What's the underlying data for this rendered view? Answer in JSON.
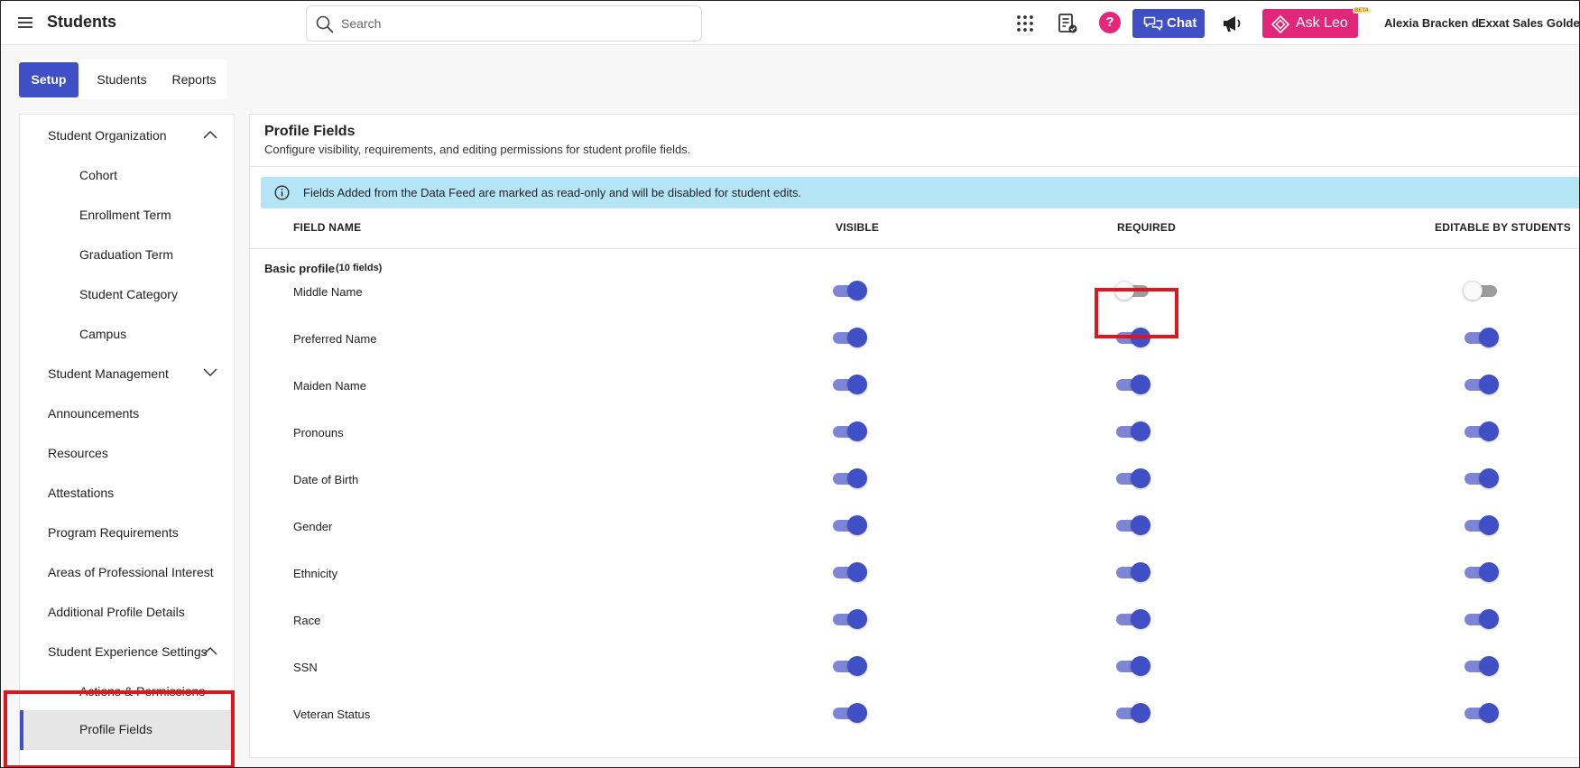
{
  "header": {
    "app_title": "Students",
    "search_placeholder": "Search",
    "chat_label": "Chat",
    "ask_leo_label": "Ask Leo",
    "beta_badge": "BETA",
    "help_label": "?",
    "user_name": "Alexia Bracken d",
    "org_name": "Exxat Sales Golden"
  },
  "tabs": [
    {
      "label": "Setup",
      "active": true
    },
    {
      "label": "Students",
      "active": false
    },
    {
      "label": "Reports",
      "active": false
    }
  ],
  "sidebar": {
    "items": [
      {
        "label": "Student Organization",
        "level": 0,
        "chevron": "up"
      },
      {
        "label": "Cohort",
        "level": 1
      },
      {
        "label": "Enrollment Term",
        "level": 1
      },
      {
        "label": "Graduation Term",
        "level": 1
      },
      {
        "label": "Student Category",
        "level": 1
      },
      {
        "label": "Campus",
        "level": 1
      },
      {
        "label": "Student Management",
        "level": 0,
        "chevron": "down"
      },
      {
        "label": "Announcements",
        "level": 0
      },
      {
        "label": "Resources",
        "level": 0
      },
      {
        "label": "Attestations",
        "level": 0
      },
      {
        "label": "Program Requirements",
        "level": 0
      },
      {
        "label": "Areas of Professional Interest",
        "level": 0
      },
      {
        "label": "Additional Profile Details",
        "level": 0
      },
      {
        "label": "Student Experience Settings",
        "level": 0,
        "chevron": "up"
      },
      {
        "label": "Actions & Permissions",
        "level": 1
      },
      {
        "label": "Profile Fields",
        "level": 1,
        "selected": true
      }
    ]
  },
  "panel": {
    "title": "Profile Fields",
    "subtitle": "Configure visibility, requirements, and editing permissions for student profile fields.",
    "info_banner": "Fields Added from the Data Feed are marked as read-only and will be disabled for student edits.",
    "columns": {
      "field_name": "FIELD NAME",
      "visible": "VISIBLE",
      "required": "REQUIRED",
      "editable": "EDITABLE BY STUDENTS"
    },
    "section": {
      "title": "Basic profile",
      "count": "(10 fields)"
    },
    "rows": [
      {
        "label": "Middle Name",
        "visible": true,
        "required": false,
        "editable": false
      },
      {
        "label": "Preferred Name",
        "visible": true,
        "required": true,
        "editable": true
      },
      {
        "label": "Maiden Name",
        "visible": true,
        "required": true,
        "editable": true
      },
      {
        "label": "Pronouns",
        "visible": true,
        "required": true,
        "editable": true
      },
      {
        "label": "Date of Birth",
        "visible": true,
        "required": true,
        "editable": true
      },
      {
        "label": "Gender",
        "visible": true,
        "required": true,
        "editable": true
      },
      {
        "label": "Ethnicity",
        "visible": true,
        "required": true,
        "editable": true
      },
      {
        "label": "Race",
        "visible": true,
        "required": true,
        "editable": true
      },
      {
        "label": "SSN",
        "visible": true,
        "required": true,
        "editable": true
      },
      {
        "label": "Veteran Status",
        "visible": true,
        "required": true,
        "editable": true
      }
    ]
  },
  "colors": {
    "primary": "#3f4fc6",
    "toggle_track_on": "#7c85d6",
    "toggle_track_off": "#9c9c9c",
    "ask_leo": "#e2267a",
    "info_banner": "#b4e5f7",
    "highlight": "#e0161e"
  }
}
